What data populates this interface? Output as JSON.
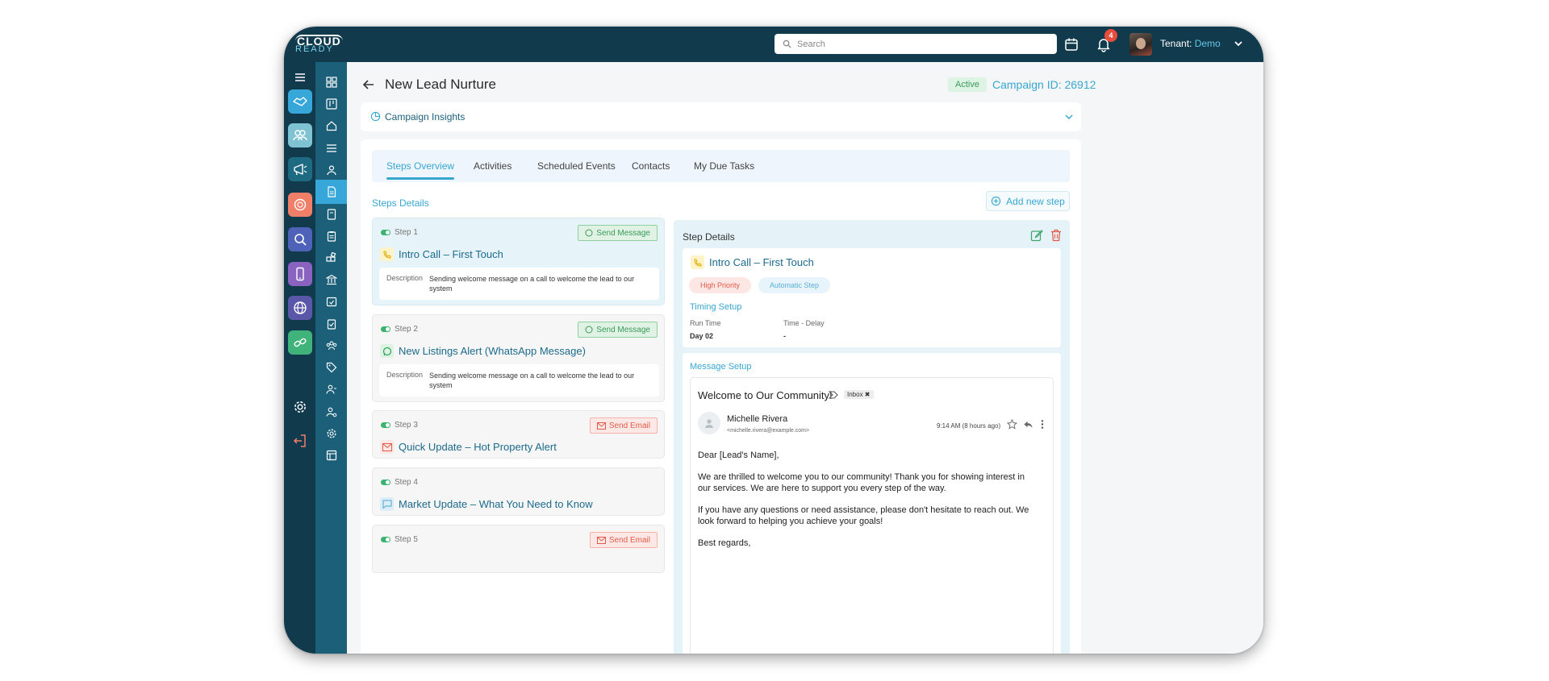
{
  "app": {
    "logo_top": "CLOUD",
    "logo_bottom": "READY"
  },
  "header": {
    "search_placeholder": "Search",
    "notifications_count": "4",
    "tenant_label": "Tenant:",
    "tenant_value": "Demo"
  },
  "page": {
    "title": "New Lead Nurture",
    "status": "Active",
    "campaign_id": "Campaign ID: 26912",
    "insights_label": "Campaign Insights"
  },
  "tabs": [
    "Steps Overview",
    "Activities",
    "Scheduled Events",
    "Contacts",
    "My Due Tasks"
  ],
  "steps_section": {
    "label": "Steps Details",
    "add_button": "Add new step"
  },
  "steps": [
    {
      "number": "Step 1",
      "action": "Send Message",
      "title": "Intro Call – First Touch",
      "desc_label": "Description",
      "desc": "Sending welcome message on a call to welcome the lead to our system"
    },
    {
      "number": "Step 2",
      "action": "Send Message",
      "title": "New Listings Alert (WhatsApp Message)",
      "desc_label": "Description",
      "desc": "Sending welcome message on a call to welcome the lead to our system"
    },
    {
      "number": "Step 3",
      "action": "Send Email",
      "title": "Quick Update – Hot Property Alert"
    },
    {
      "number": "Step 4",
      "title": "Market Update – What You Need to Know"
    },
    {
      "number": "Step 5",
      "action": "Send Email"
    }
  ],
  "detail": {
    "header": "Step Details",
    "title": "Intro Call – First Touch",
    "priority": "High Priority",
    "step_type": "Automatic Step",
    "timing_label": "Timing Setup",
    "run_time_label": "Run Time",
    "run_time_value": "Day 02",
    "delay_label": "Time - Delay",
    "delay_value": "-",
    "message_label": "Message Setup"
  },
  "email": {
    "subject": "Welcome to Our Community!",
    "tag": "Inbox ✖",
    "sender_name": "Michelle Rivera",
    "sender_email": "<michelle.rivera@example.com>",
    "time": "9:14 AM (8 hours ago)",
    "greeting": "Dear [Lead's Name],",
    "para1": "We are thrilled to welcome you to our community! Thank you for showing interest in our services. We are here to support you every step of the way.",
    "para2": "If you have any questions or need assistance, please don't hesitate to reach out. We look forward to helping you achieve your goals!",
    "signoff": "Best regards,"
  }
}
